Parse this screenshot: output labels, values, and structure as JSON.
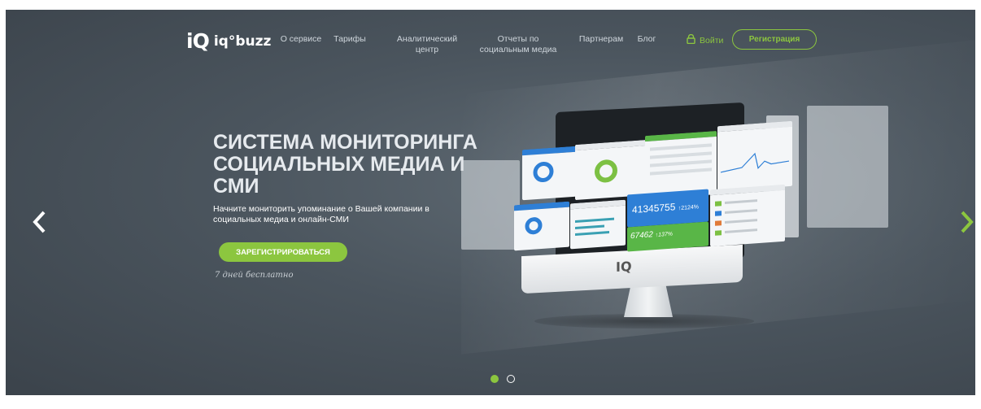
{
  "header": {
    "logo_mark": "iQ",
    "logo_text": "iq°buzz",
    "nav": [
      {
        "label": "О сервисе"
      },
      {
        "label": "Тарифы"
      },
      {
        "label": "Аналитический центр"
      },
      {
        "label": "Отчеты по социальным медиа"
      },
      {
        "label": "Партнерам"
      },
      {
        "label": "Блог"
      }
    ],
    "login_label": "Войти",
    "register_label": "Регистрация"
  },
  "hero": {
    "headline": "СИСТЕМА МОНИТОРИНГА СОЦИАЛЬНЫХ МЕДИА И СМИ",
    "subtitle": "Начните мониторить упоминание о Вашей компании в социальных медиа и онлайн-СМИ",
    "cta_label": "ЗАРЕГИСТРИРОВАТЬСЯ",
    "trial_note": "7 дней бесплатно"
  },
  "illustration": {
    "big_number": "41345755",
    "big_number_delta": "↑2124%",
    "small_number": "67462",
    "small_number_delta": "↑137%",
    "monitor_logo": "IQ"
  },
  "carousel": {
    "slide_count": 2,
    "active_index": 0
  },
  "colors": {
    "accent": "#8cc63f",
    "background": "#4b555e",
    "blue_panel": "#2e7fd6",
    "green_panel": "#59b647"
  },
  "icons": [
    "lock-icon",
    "chevron-left-icon",
    "chevron-right-icon"
  ]
}
